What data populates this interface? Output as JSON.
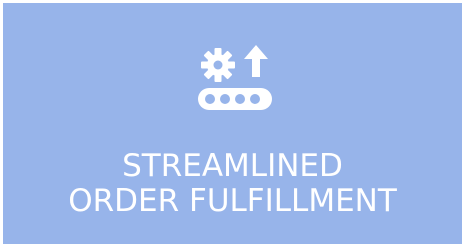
{
  "tile": {
    "icon": "conveyor-gear-arrow-icon",
    "title_line1": "STREAMLINED",
    "title_line2": "ORDER FULFILLMENT",
    "background_color": "#97b4ea",
    "text_color": "#ffffff"
  }
}
